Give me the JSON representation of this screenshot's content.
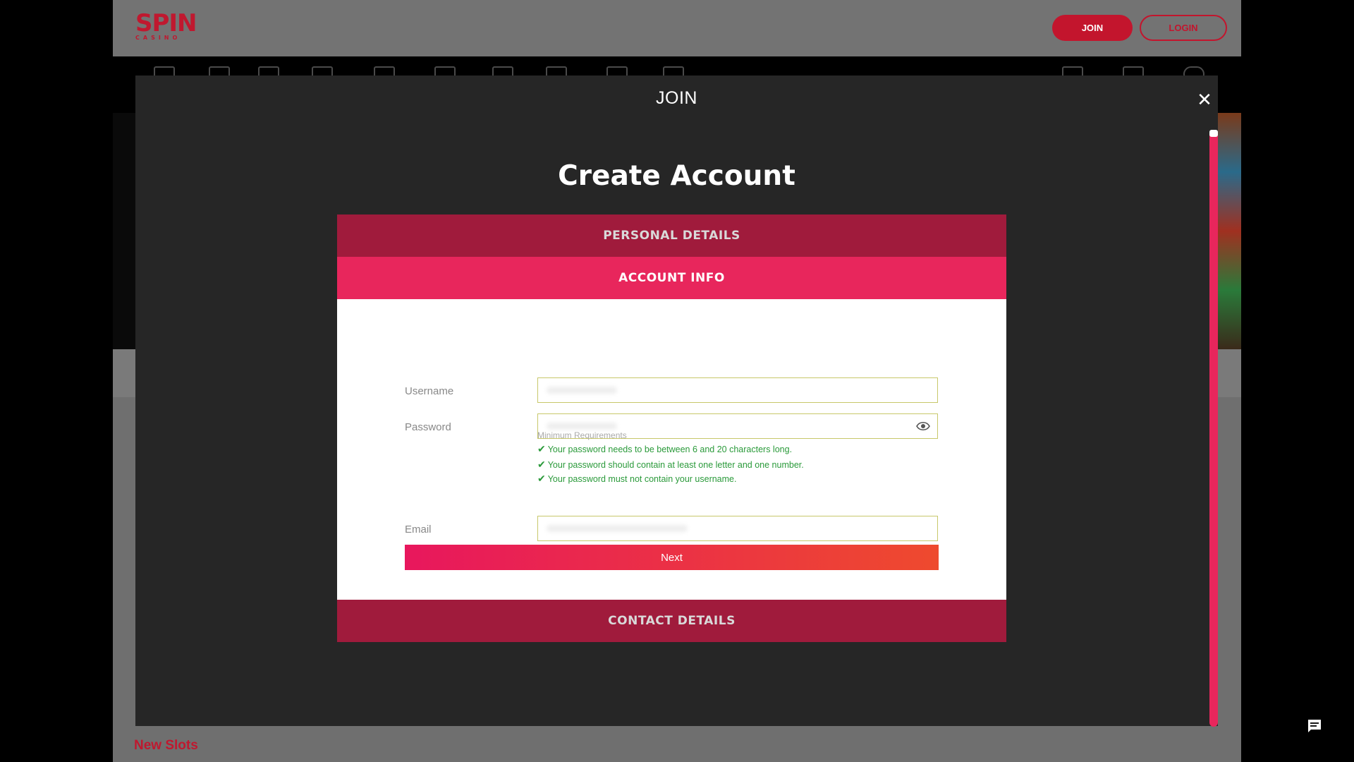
{
  "site": {
    "logo_text": "SPIN",
    "logo_subtext": "CASINO",
    "join_label": "JOIN",
    "login_label": "LOGIN",
    "nav_icons": [
      "home-icon",
      "sports-icon",
      "slots-icon",
      "live-casino-icon",
      "jackpot-icon",
      "roulette-icon",
      "cards-icon",
      "blackjack-icon",
      "table-games-icon",
      "promotions-icon",
      "games-icon",
      "tv-icon",
      "search-icon"
    ],
    "section_title": "New Slots"
  },
  "modal": {
    "title": "JOIN",
    "close_icon": "close-icon",
    "heading": "Create Account",
    "steps": {
      "personal": "PERSONAL DETAILS",
      "account": "ACCOUNT INFO",
      "contact": "CONTACT DETAILS"
    },
    "form": {
      "username_label": "Username",
      "password_label": "Password",
      "email_label": "Email",
      "min_requirements": "Minimum Requirements",
      "rules": [
        "Your password needs to be between 6 and 20 characters long.",
        "Your password should contain at least one letter and one number.",
        "Your password must not contain your username."
      ],
      "next_label": "Next"
    }
  },
  "colors": {
    "accent": "#e8265c",
    "accent_dark": "#a01b3c",
    "brand_red": "#c3152d",
    "success_green": "#2a9a3a"
  }
}
